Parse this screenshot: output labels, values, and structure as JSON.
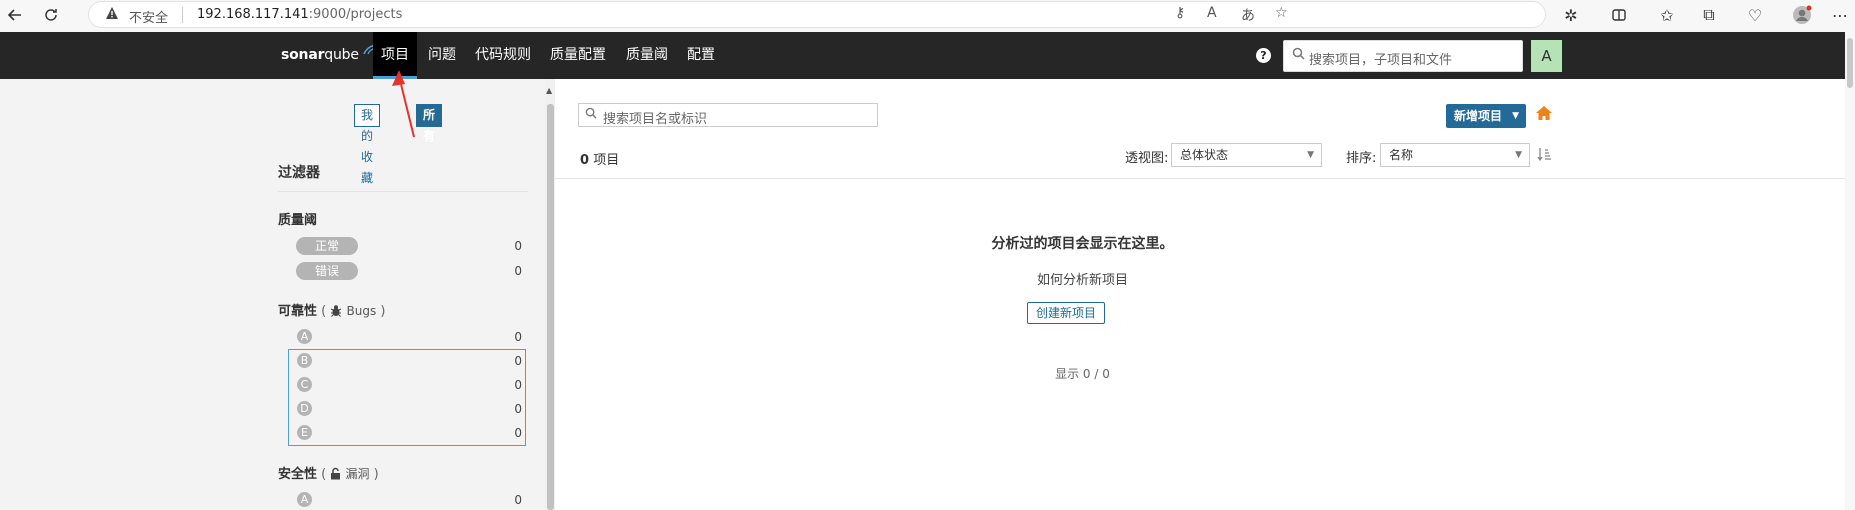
{
  "browser": {
    "insecure_label": "不安全",
    "url_host": "192.168.117.141",
    "url_rest": ":9000/projects"
  },
  "nav": {
    "logo_bold": "sonar",
    "logo_light": "qube",
    "items": [
      "项目",
      "问题",
      "代码规则",
      "质量配置",
      "质量阈",
      "配置"
    ],
    "search_placeholder": "搜索项目，子项目和文件",
    "avatar": "A",
    "help": "?"
  },
  "sidebar": {
    "toggle": {
      "favorites": "我的收藏",
      "all": "所有"
    },
    "filter_title": "过滤器",
    "quality_gate": {
      "title": "质量阈",
      "items": [
        {
          "label": "正常",
          "count": "0"
        },
        {
          "label": "错误",
          "count": "0"
        }
      ]
    },
    "reliability": {
      "title": "可靠性",
      "paren_open": "(",
      "sub": "Bugs",
      "paren_close": ")",
      "ratings": [
        {
          "grade": "A",
          "count": "0"
        },
        {
          "grade": "B",
          "count": "0"
        },
        {
          "grade": "C",
          "count": "0"
        },
        {
          "grade": "D",
          "count": "0"
        },
        {
          "grade": "E",
          "count": "0"
        }
      ]
    },
    "security": {
      "title": "安全性",
      "paren_open": "(",
      "sub": "漏洞",
      "paren_close": ")",
      "ratings": [
        {
          "grade": "A",
          "count": "0"
        }
      ]
    }
  },
  "main": {
    "search_placeholder": "搜索项目名或标识",
    "new_project": "新增项目",
    "project_count": "0",
    "project_count_unit": "项目",
    "perspective_label": "透视图:",
    "perspective_value": "总体状态",
    "sort_label": "排序:",
    "sort_value": "名称",
    "empty_title": "分析过的项目会显示在这里。",
    "empty_sub": "如何分析新项目",
    "create_button": "创建新项目",
    "shown": "显示 0 / 0"
  },
  "colors": {
    "nav_bg": "#262626",
    "accent": "#236a97",
    "annotation_arrow": "#e8312a",
    "home_icon": "#f0811d"
  }
}
